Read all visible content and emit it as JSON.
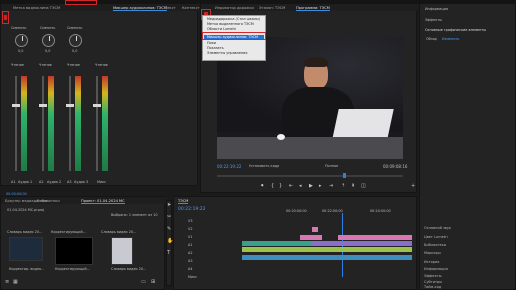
{
  "top_panel": {
    "tabs": [
      "Метка видеоклипа ТЭСМ",
      "Подсказка",
      "Метаданные",
      "Эффекты"
    ],
    "active_tab": "Микшер аудиоклипов: ТЭСМ",
    "mixer_tabs": [
      "Микшер аудиоклипов: ТЭСМ",
      "Текст",
      "Контекст"
    ],
    "center_tabs": [
      "Индикатор дорожки",
      "Эталон: ТЭСМ",
      "Программа: ТЭСМ"
    ],
    "right_tabs": [
      "Информация",
      "Эффекты"
    ]
  },
  "mixer": {
    "channel_labels": [
      "Сменить",
      "Сменить",
      "Сменить",
      "Сменить"
    ],
    "knob_values": [
      "0,0",
      "0,0",
      "0,0",
      "0,0"
    ],
    "mode_labels": [
      "Чтение",
      "Чтение",
      "Чтение",
      "Чтение"
    ],
    "track_names": [
      "A1",
      "Аудио 1",
      "A2",
      "Аудио 2",
      "A3",
      "Аудио 3",
      "Микс"
    ],
    "footer_time": "00:00:00:00",
    "footer_frame": "00:00:00:00"
  },
  "menu": {
    "items": [
      "Закрыть панель",
      "Отменить закрепление панели",
      "Закрыть другие панели в группе",
      "Размер группы панелей",
      "Вкладка",
      "Микшер аудиоклипов: ТЭСМ",
      "Пики",
      "Показать",
      "Элементы управления"
    ],
    "highlighted": "Микшер аудиоклипов: ТЭСМ",
    "top_items": [
      "Медиадорожка (Стил шкалы)",
      "Метка выделенного ТЭСМ",
      "Области Lumetri"
    ]
  },
  "program": {
    "timecode": "00:22:19:22",
    "fit_label": "Установить кадр",
    "quality_label": "Полное",
    "duration": "00:09:08:16"
  },
  "project": {
    "tabs": [
      "Браузер медиаданных",
      "Библиотеки",
      "Проект: 01-04-2024 МС"
    ],
    "file_name": "01-04-2024 МС.prproj",
    "item_count": "Выбрано: 1 элемент из 10",
    "items": [
      {
        "label": "Словарь видео 20...",
        "duration": "2:00"
      },
      {
        "label": "Корректирующий...",
        "duration": "2:00"
      },
      {
        "label": "Словарь видео 20...",
        "duration": "0:03"
      }
    ],
    "row2": [
      {
        "label": "Корректир. видео...",
        "duration": "2:00"
      },
      {
        "label": "Корректирующий...",
        "duration": "0:03"
      },
      {
        "label": "Словарь видео 20...",
        "duration": "0:03"
      }
    ]
  },
  "timeline": {
    "tab": "ТЭСМ",
    "timecode": "00:22:19:22",
    "ruler_marks": [
      "00:20:00:00",
      "00:22:00:00",
      "00:24:00:00"
    ],
    "tracks": [
      "V3",
      "V2",
      "V1",
      "A1",
      "A2",
      "A3",
      "A4",
      "Микс"
    ]
  },
  "right_panel": {
    "section1": "Основные графические элементы",
    "section1_tabs": [
      "Обзор",
      "Изменить"
    ],
    "list_items": [
      "Основной звук",
      "Цвет Lumetri",
      "Библиотеки",
      "Маркеры",
      "История",
      "Информация",
      "Эффекты",
      "Субтитры",
      "Тайм-код"
    ]
  },
  "colors": {
    "accent": "#3a8dde",
    "highlight_red": "#d0282b",
    "clip_pink": "#d778b4",
    "clip_teal": "#37a18e",
    "clip_lime": "#9bc24a",
    "playhead": "#2d7fe6"
  }
}
